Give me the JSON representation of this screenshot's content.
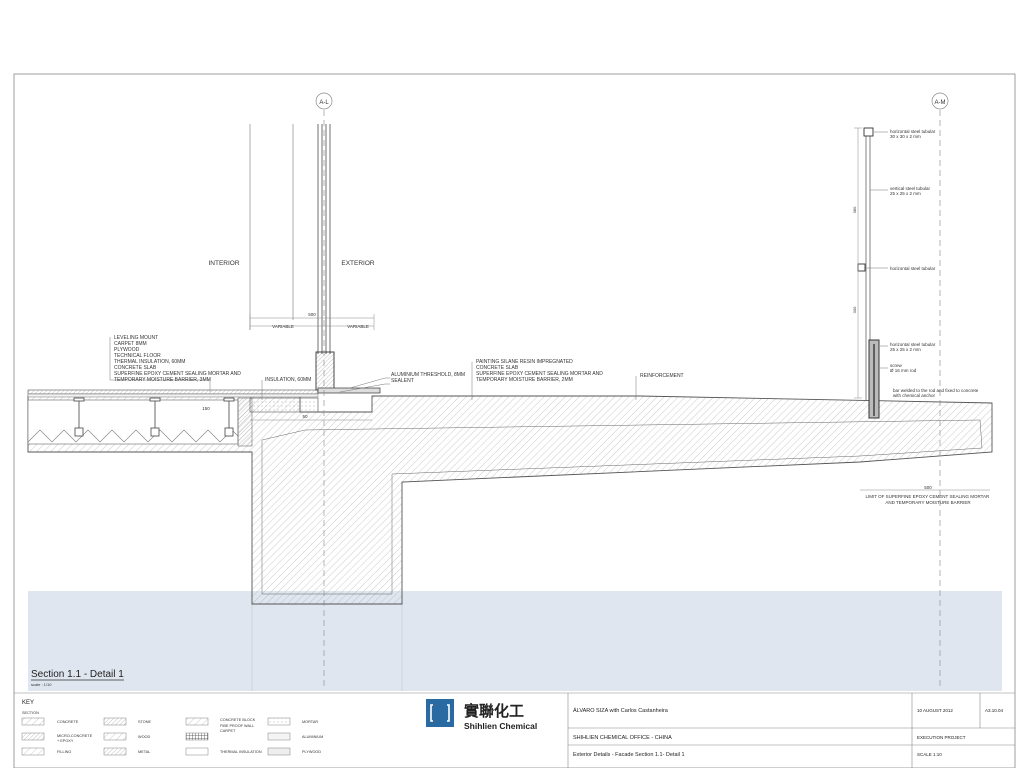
{
  "drawing": {
    "grid_left": "A-L",
    "grid_right": "A-M",
    "label_interior": "INTERIOR",
    "label_exterior": "EXTERIOR",
    "dim_500": "500",
    "dim_variable_left": "VARIABLE",
    "dim_variable_right": "VARIABLE",
    "dim_bottom": "500",
    "dim_150": "150",
    "dim_380": "380",
    "dim_300": "300",
    "dim_50": "50",
    "dim_800": "800",
    "left_callout": [
      "LEVELING MOUNT",
      "CARPET 8MM",
      "PLYWOOD",
      "TECHNICAL FLOOR",
      "THERMAL INSULATION, 60MM",
      "CONCRETE SLAB",
      "SUPERFINE EPOXY CEMENT SEALING MORTAR AND",
      "TEMPORARY MOISTURE BARRIER, 3MM"
    ],
    "insulation_label": "INSULATION, 60MM",
    "aluminium_label": "ALUMINIUM THRESHOLD, 8MM",
    "sealent_label": "SEALENT",
    "middle_callout": [
      "PAINTING SILANE RESIN IMPREGNATED",
      "CONCRETE SLAB",
      "SUPERFINE EPOXY CEMENT SEALING MORTAR AND",
      "TEMPORARY MOISTURE BARRIER, 2MM"
    ],
    "reinforcement_label": "REINFORCEMENT",
    "rail_labels": [
      [
        "horizontal steel tubular",
        "30 x 30 x 2 mm"
      ],
      [
        "vertical steel tubular",
        "25 x 25 x 2 mm"
      ],
      [
        "horizontal steel tubular"
      ],
      [
        "horizontal steel tubular",
        "25 x 25 x 2 mm"
      ],
      [
        "screw",
        "Ø 16 mm rod"
      ],
      [
        "bar welded to the rod and fixed to concrete",
        "with chemical anchor"
      ]
    ],
    "limit_label": [
      "LIMIT OF SUPERFINE EPOXY CEMENT SEALING MORTAR",
      "AND TEMPORARY MOISTURE BARRIER"
    ],
    "section_title": "Section 1.1 - Detail 1",
    "section_scale": "scale : 1/10"
  },
  "legend": {
    "title": "KEY",
    "subtitle": "SECTION",
    "items": [
      {
        "label": "CONCRETE"
      },
      {
        "label": "STONE"
      },
      {
        "label": "CONCRETE BLOCK"
      },
      {
        "label": "FIBE PROOF WALL"
      },
      {
        "label": "MORTAR"
      },
      {
        "label": "MICRO-CONCRETE"
      },
      {
        "label": "+ EPOXY"
      },
      {
        "label": "WOOD"
      },
      {
        "label": "CARPET"
      },
      {
        "label": "ALUMINIUM"
      },
      {
        "label": "FILLING"
      },
      {
        "label": "METAL"
      },
      {
        "label": "THERMAL INSULATION"
      },
      {
        "label": "PLYWOOD"
      }
    ]
  },
  "logo": {
    "chinese": "實聯化工",
    "english": "Shihlien Chemical",
    "color": "#2a6aa3"
  },
  "title_block": {
    "architect": "ÁLVARO SIZA with Carlos Castanheira",
    "date": "10 AUGUST 2012",
    "sheet_no": "A3.10.04",
    "project": "SHIHLIEN CHEMICAL OFFICE - CHINA",
    "phase": "EXECUTION PROJECT",
    "drawing_title": "Exterior Details - Facade Section 1.1- Detail 1",
    "scale": "SCALE 1:10"
  },
  "colors": {
    "ground_fill": "#dfe6ef",
    "line": "#555555",
    "hatch": "#9a9a9a"
  }
}
